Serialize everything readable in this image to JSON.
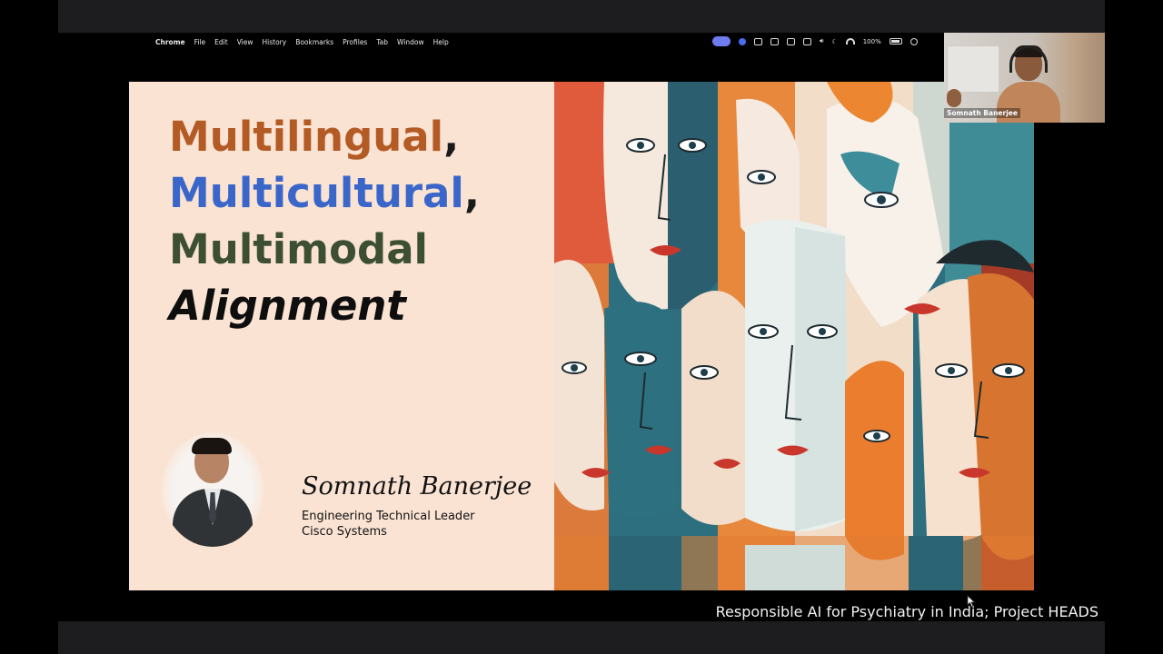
{
  "menubar": {
    "app_name": "Chrome",
    "items": [
      "File",
      "Edit",
      "View",
      "History",
      "Bookmarks",
      "Profiles",
      "Tab",
      "Window",
      "Help"
    ],
    "battery_percent": "100%"
  },
  "slide": {
    "title": {
      "line1_word": "Multilingual",
      "line2_word": "Multicultural",
      "line3_word": "Multimodal",
      "line4_word": "Alignment",
      "comma": ","
    },
    "speaker": {
      "name": "Somnath Banerjee",
      "role": "Engineering Technical Leader",
      "company": "Cisco Systems"
    }
  },
  "video_tile": {
    "participant_name": "Somnath Banerjee"
  },
  "caption": "Responsible AI for Psychiatry in India; Project HEADS",
  "colors": {
    "slide_background": "#fae3d3",
    "title_line1": "#b35a25",
    "title_line2": "#3b66c9",
    "title_line3": "#3d4f32",
    "title_line4": "#0e0e0e"
  }
}
